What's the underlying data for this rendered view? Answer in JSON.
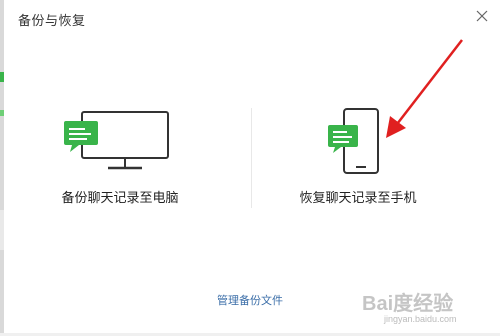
{
  "window": {
    "title": "备份与恢复",
    "close_icon": "close-icon"
  },
  "options": [
    {
      "label": "备份聊天记录至电脑",
      "icon": "monitor-chat-icon"
    },
    {
      "label": "恢复聊天记录至手机",
      "icon": "phone-chat-icon"
    }
  ],
  "footer": {
    "manage_link": "管理备份文件"
  },
  "annotation": {
    "arrow_color": "#e02020"
  },
  "watermark": {
    "brand": "Bai度经验",
    "url": "jingyan.baidu.com"
  },
  "colors": {
    "accent": "#39b44a",
    "link": "#3b6ea8",
    "icon_stroke": "#333333"
  }
}
